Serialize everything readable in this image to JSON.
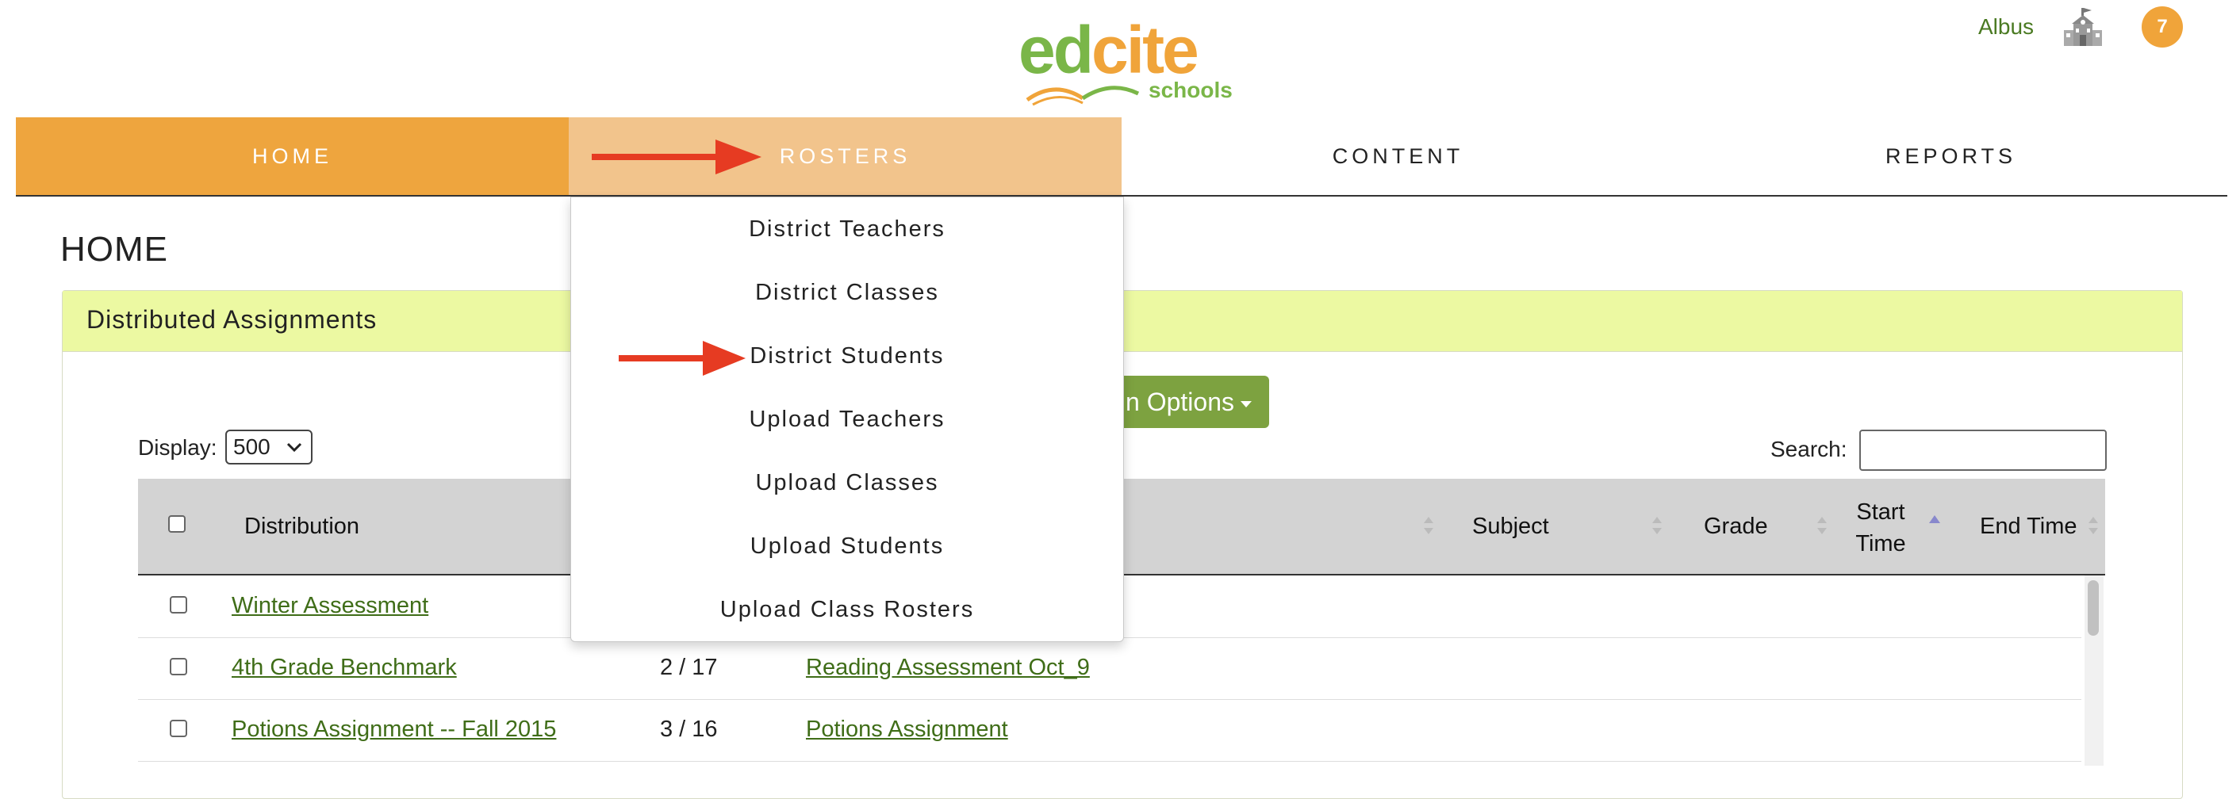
{
  "brand": {
    "logo_word_ed": "ed",
    "logo_word_cite": "cite",
    "logo_sub": "schools",
    "primary_color": "#eea53e",
    "accent_green": "#7da240"
  },
  "header": {
    "user_name": "Albus",
    "school_icon": "school-building-icon",
    "notification_count": "7"
  },
  "nav": {
    "tabs": [
      {
        "label": "HOME"
      },
      {
        "label": "ROSTERS"
      },
      {
        "label": "CONTENT"
      },
      {
        "label": "REPORTS"
      }
    ]
  },
  "page": {
    "title": "HOME"
  },
  "panel": {
    "title": "Distributed Assignments",
    "options_label_visible": "n Options"
  },
  "controls": {
    "display_label": "Display:",
    "display_value": "500",
    "search_label": "Search:",
    "search_value": ""
  },
  "table": {
    "columns": [
      {
        "label": "Distribution"
      },
      {
        "label": "Subject"
      },
      {
        "label": "Grade"
      },
      {
        "label": "Start Time"
      },
      {
        "label": "End Time"
      }
    ],
    "rows": [
      {
        "distribution": "Winter Assessment",
        "ratio": "",
        "assignment": ""
      },
      {
        "distribution": "4th Grade Benchmark",
        "ratio": "2 / 17",
        "assignment": "Reading Assessment Oct_9"
      },
      {
        "distribution": "Potions Assignment -- Fall 2015",
        "ratio": "3 / 16",
        "assignment": "Potions Assignment"
      }
    ]
  },
  "rosters_menu": {
    "items": [
      {
        "label": "District Teachers"
      },
      {
        "label": "District Classes"
      },
      {
        "label": "District Students"
      },
      {
        "label": "Upload Teachers"
      },
      {
        "label": "Upload Classes"
      },
      {
        "label": "Upload Students"
      },
      {
        "label": "Upload Class Rosters"
      }
    ]
  },
  "annotations": {
    "arrow_color": "#e63b22"
  }
}
